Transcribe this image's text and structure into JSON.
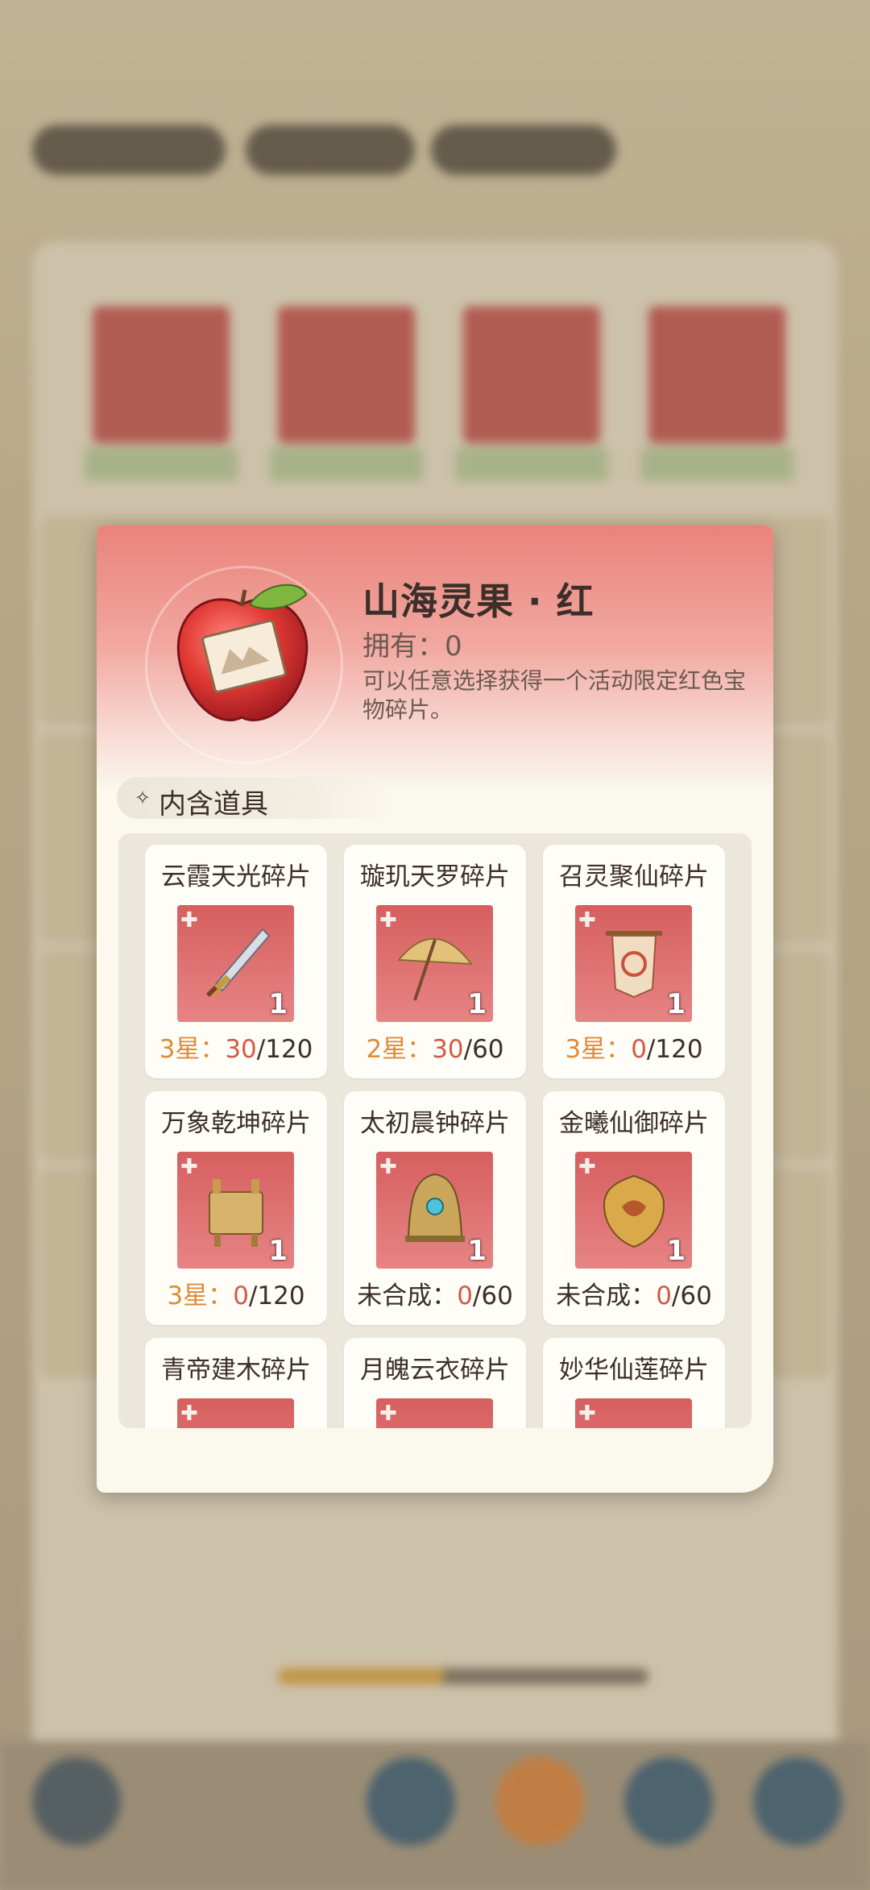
{
  "dialog": {
    "item_name": "山海灵果 · 红",
    "owned_label": "拥有：",
    "owned_count": "0",
    "description": "可以任意选择获得一个活动限定红色宝物碎片。",
    "section_title": "内含道具"
  },
  "items": [
    {
      "name": "云霞天光碎片",
      "qty": "1",
      "status_prefix": "3星：",
      "current": "30",
      "total": "/120",
      "icon": "sword-icon"
    },
    {
      "name": "璇玑天罗碎片",
      "qty": "1",
      "status_prefix": "2星：",
      "current": "30",
      "total": "/60",
      "icon": "umbrella-icon"
    },
    {
      "name": "召灵聚仙碎片",
      "qty": "1",
      "status_prefix": "3星：",
      "current": "0",
      "total": "/120",
      "icon": "banner-icon"
    },
    {
      "name": "万象乾坤碎片",
      "qty": "1",
      "status_prefix": "3星：",
      "current": "0",
      "total": "/120",
      "icon": "cauldron-icon"
    },
    {
      "name": "太初晨钟碎片",
      "qty": "1",
      "status_prefix": "未合成：",
      "current": "0",
      "total": "/60",
      "icon": "bell-icon"
    },
    {
      "name": "金曦仙御碎片",
      "qty": "1",
      "status_prefix": "未合成：",
      "current": "0",
      "total": "/60",
      "icon": "shield-icon"
    },
    {
      "name": "青帝建木碎片",
      "qty": "",
      "status_prefix": "",
      "current": "",
      "total": "",
      "icon": "tree-icon"
    },
    {
      "name": "月魄云衣碎片",
      "qty": "",
      "status_prefix": "",
      "current": "",
      "total": "",
      "icon": "robe-icon"
    },
    {
      "name": "妙华仙莲碎片",
      "qty": "",
      "status_prefix": "",
      "current": "",
      "total": "",
      "icon": "lotus-icon"
    }
  ],
  "colors": {
    "header_red": "#e9837c",
    "star_orange": "#e08b38",
    "count_red": "#d25a4a",
    "art_bg": "#d65f5f"
  }
}
